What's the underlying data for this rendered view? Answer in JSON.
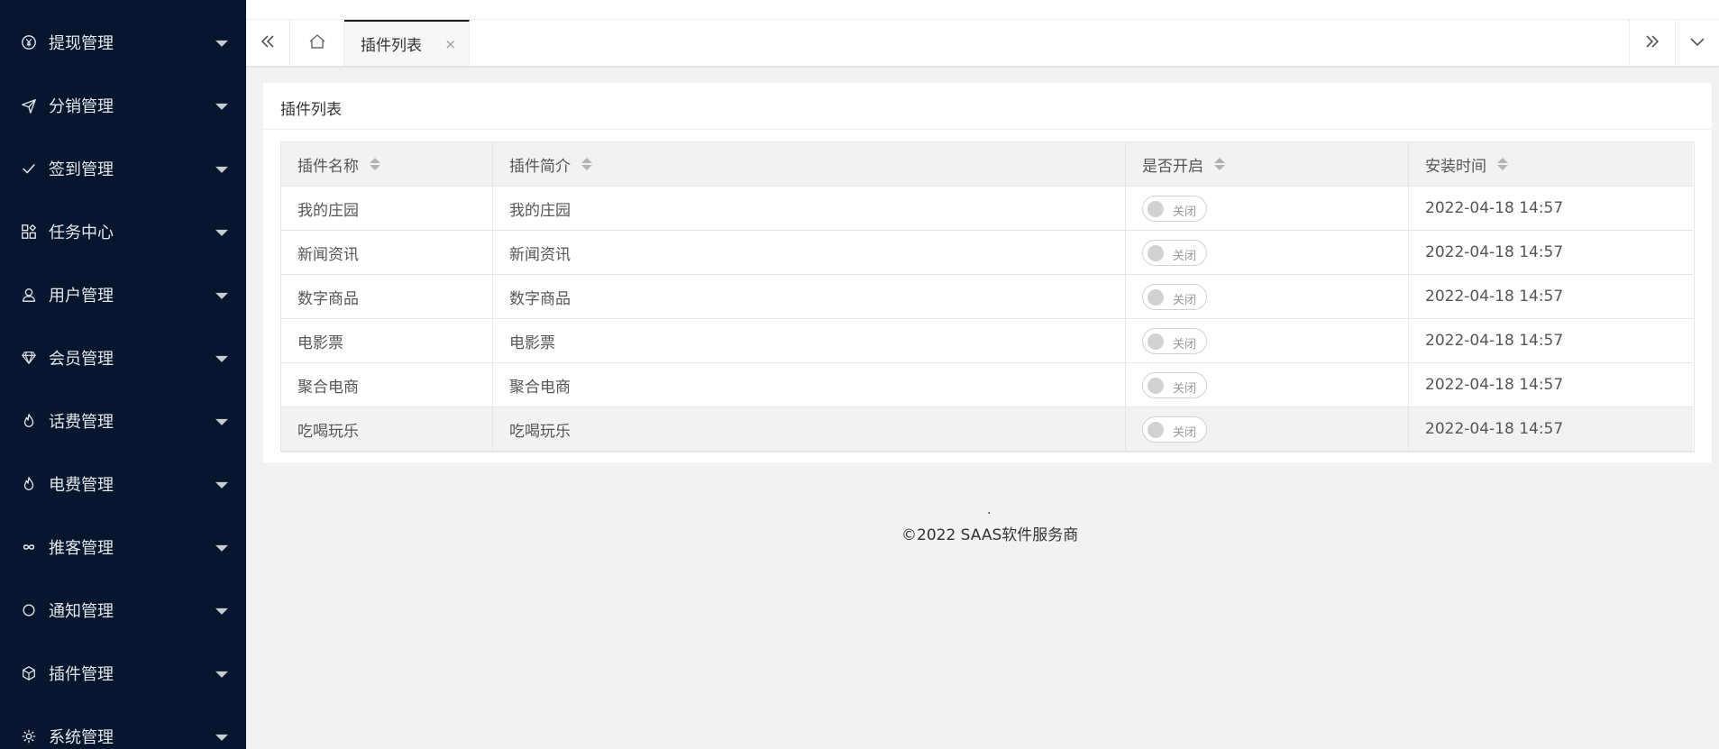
{
  "sidebar": {
    "items": [
      {
        "label": "提现管理",
        "icon": "yen-circle-icon"
      },
      {
        "label": "分销管理",
        "icon": "send-icon"
      },
      {
        "label": "签到管理",
        "icon": "check-icon"
      },
      {
        "label": "任务中心",
        "icon": "apps-grid-icon"
      },
      {
        "label": "用户管理",
        "icon": "user-icon"
      },
      {
        "label": "会员管理",
        "icon": "diamond-icon"
      },
      {
        "label": "话费管理",
        "icon": "fire-icon"
      },
      {
        "label": "电费管理",
        "icon": "fire-icon"
      },
      {
        "label": "推客管理",
        "icon": "infinity-icon"
      },
      {
        "label": "通知管理",
        "icon": "chat-bubble-icon"
      },
      {
        "label": "插件管理",
        "icon": "cube-icon"
      },
      {
        "label": "系统管理",
        "icon": "gear-icon"
      }
    ]
  },
  "tabbar": {
    "active_tab": "插件列表",
    "close_glyph": "×"
  },
  "card": {
    "title": "插件列表"
  },
  "table": {
    "columns": [
      "插件名称",
      "插件简介",
      "是否开启",
      "安装时间"
    ],
    "rows": [
      {
        "name": "我的庄园",
        "desc": "我的庄园",
        "status": "关闭",
        "time": "2022-04-18 14:57"
      },
      {
        "name": "新闻资讯",
        "desc": "新闻资讯",
        "status": "关闭",
        "time": "2022-04-18 14:57"
      },
      {
        "name": "数字商品",
        "desc": "数字商品",
        "status": "关闭",
        "time": "2022-04-18 14:57"
      },
      {
        "name": "电影票",
        "desc": "电影票",
        "status": "关闭",
        "time": "2022-04-18 14:57"
      },
      {
        "name": "聚合电商",
        "desc": "聚合电商",
        "status": "关闭",
        "time": "2022-04-18 14:57"
      },
      {
        "name": "吃喝玩乐",
        "desc": "吃喝玩乐",
        "status": "关闭",
        "time": "2022-04-18 14:57"
      }
    ]
  },
  "footer": {
    "dot": ".",
    "text": "©2022 SAAS软件服务商"
  },
  "colors": {
    "sidebar_bg": "#06162f",
    "page_bg": "#f2f2f2",
    "active_tab_border": "#1a1a1a"
  }
}
